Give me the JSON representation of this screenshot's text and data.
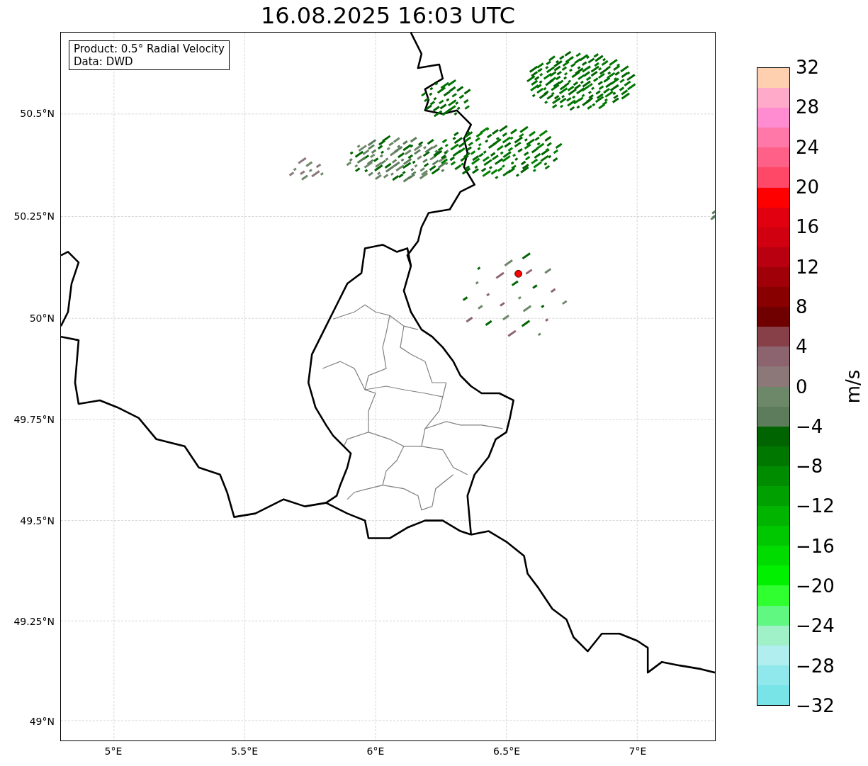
{
  "title": "16.08.2025 16:03 UTC",
  "info_box": [
    "Product: 0.5° Radial Velocity",
    "Data: DWD"
  ],
  "y_ticks": [
    "50.5°N",
    "50.25°N",
    "50°N",
    "49.75°N",
    "49.5°N",
    "49.25°N",
    "49°N"
  ],
  "x_ticks": [
    "5°E",
    "5.5°E",
    "6°E",
    "6.5°E",
    "7°E"
  ],
  "colorbar": {
    "label": "m/s",
    "ticks": [
      "32",
      "28",
      "24",
      "20",
      "16",
      "12",
      "8",
      "4",
      "0",
      "−4",
      "−8",
      "−12",
      "−16",
      "−20",
      "−24",
      "−28",
      "−32"
    ],
    "bins": [
      {
        "color": "#ffd0b0"
      },
      {
        "color": "#ffaac8"
      },
      {
        "color": "#ff8cd0"
      },
      {
        "color": "#ff78a8"
      },
      {
        "color": "#ff6088"
      },
      {
        "color": "#ff4868"
      },
      {
        "color": "#ff0000"
      },
      {
        "color": "#e00010"
      },
      {
        "color": "#d00010"
      },
      {
        "color": "#b80010"
      },
      {
        "color": "#a00008"
      },
      {
        "color": "#880000"
      },
      {
        "color": "#700000"
      },
      {
        "color": "#884048"
      },
      {
        "color": "#8c6470"
      },
      {
        "color": "#8c7878"
      },
      {
        "color": "#6c8868"
      },
      {
        "color": "#5c7c5c"
      },
      {
        "color": "#006400"
      },
      {
        "color": "#007800"
      },
      {
        "color": "#008c00"
      },
      {
        "color": "#00a000"
      },
      {
        "color": "#00b400"
      },
      {
        "color": "#00c800"
      },
      {
        "color": "#00dc00"
      },
      {
        "color": "#00f000"
      },
      {
        "color": "#30ff30"
      },
      {
        "color": "#60f880"
      },
      {
        "color": "#a0f0c8"
      },
      {
        "color": "#b0eef0"
      },
      {
        "color": "#90e8ec"
      },
      {
        "color": "#78e4e8"
      }
    ]
  }
}
